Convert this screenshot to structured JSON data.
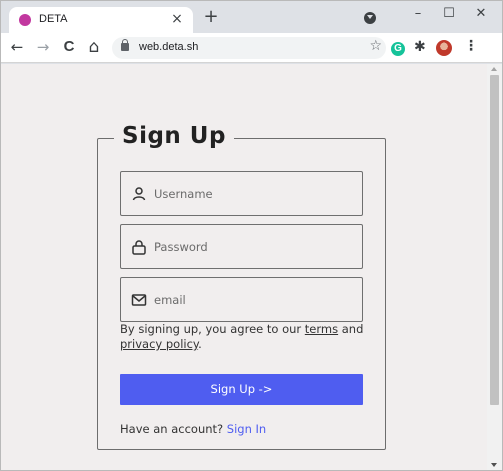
{
  "browser": {
    "tab_title": "DETA",
    "tab_close": "×",
    "new_tab": "+",
    "url": "web.deta.sh",
    "win_minimize": "–",
    "win_maximize": "☐",
    "win_close": "✕",
    "back": "←",
    "forward": "→",
    "reload": "C",
    "home": "⌂",
    "star": "☆",
    "extension_g": "G",
    "puzzle": "✱",
    "menu": "⋮",
    "favicon_color": "#c2389f"
  },
  "form": {
    "title": "Sign Up",
    "username_placeholder": "Username",
    "password_placeholder": "Password",
    "email_placeholder": "email",
    "notice_prefix": "By signing up, you agree to our ",
    "terms_link": "terms",
    "notice_and": " and",
    "privacy_link": "privacy policy",
    "notice_suffix": ".",
    "submit_label": "Sign Up ->",
    "have_account": "Have an account? ",
    "signin_link": "Sign In"
  },
  "colors": {
    "accent": "#4f5df0",
    "page_bg": "#f1eeee"
  }
}
